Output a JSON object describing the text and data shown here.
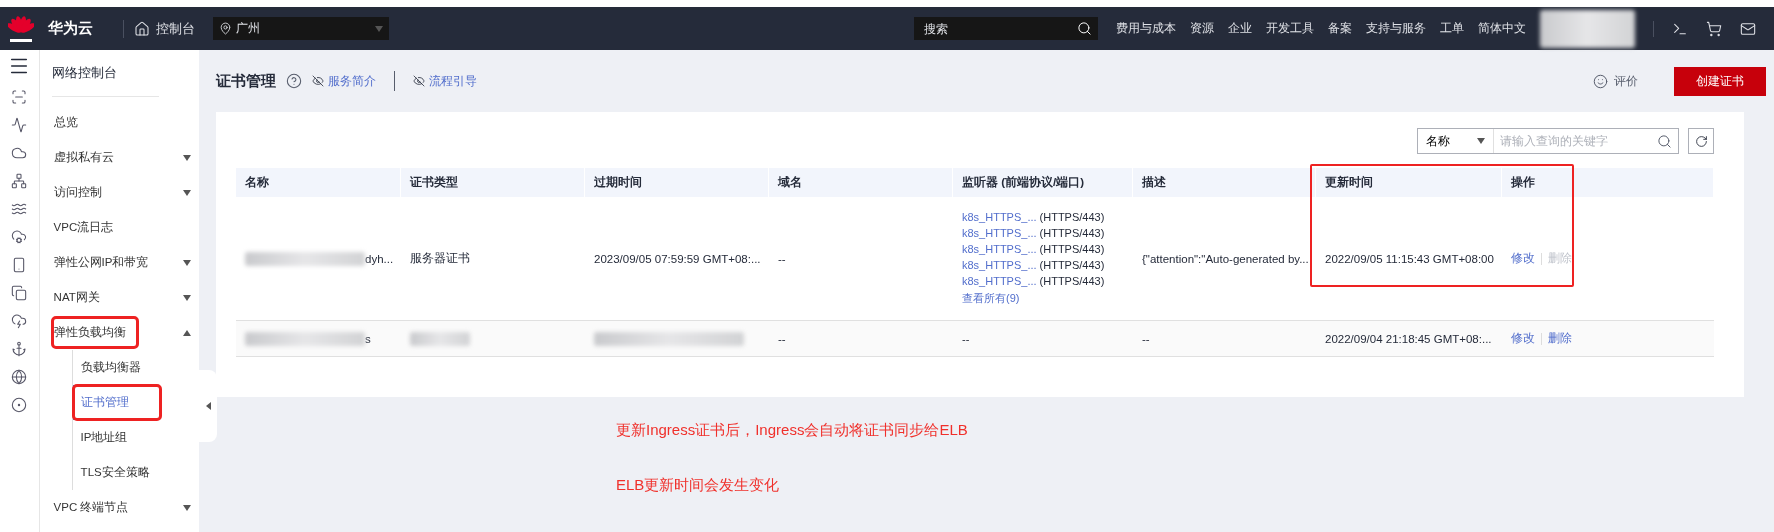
{
  "top_bar": {
    "brand": "华为云",
    "console": "控制台",
    "region": "广州",
    "search": {
      "placeholder": "搜索"
    },
    "nav": [
      "费用与成本",
      "资源",
      "企业",
      "开发工具",
      "备案",
      "支持与服务",
      "工单",
      "简体中文"
    ]
  },
  "sidebar": {
    "title": "网络控制台",
    "items": [
      {
        "label": "总览",
        "expandable": false,
        "highlighted": false
      },
      {
        "label": "虚拟私有云",
        "expandable": true,
        "expanded": false,
        "highlighted": false
      },
      {
        "label": "访问控制",
        "expandable": true,
        "expanded": false,
        "highlighted": false
      },
      {
        "label": "VPC流日志",
        "expandable": false,
        "highlighted": false
      },
      {
        "label": "弹性公网IP和带宽",
        "expandable": true,
        "expanded": false,
        "highlighted": false
      },
      {
        "label": "NAT网关",
        "expandable": true,
        "expanded": false,
        "highlighted": false
      },
      {
        "label": "弹性负载均衡",
        "expandable": true,
        "expanded": true,
        "highlighted": true,
        "children": [
          {
            "label": "负载均衡器",
            "selected": false,
            "highlighted": false
          },
          {
            "label": "证书管理",
            "selected": true,
            "highlighted": true
          },
          {
            "label": "IP地址组",
            "selected": false,
            "highlighted": false
          },
          {
            "label": "TLS安全策略",
            "selected": false,
            "highlighted": false
          }
        ]
      },
      {
        "label": "VPC 终端节点",
        "expandable": true,
        "expanded": false,
        "highlighted": false
      }
    ]
  },
  "page": {
    "title": "证书管理",
    "links": [
      "服务简介",
      "流程引导"
    ],
    "feedback": "评价",
    "create_button": "创建证书"
  },
  "filter": {
    "field": "名称",
    "placeholder": "请输入查询的关键字"
  },
  "table": {
    "update_time_highlighted": true,
    "columns": [
      "名称",
      "证书类型",
      "过期时间",
      "域名",
      "监听器 (前端协议/端口)",
      "描述",
      "更新时间",
      "操作"
    ],
    "rows": [
      {
        "name": {
          "text": "dyh...",
          "redacted": true
        },
        "type": {
          "text": "服务器证书",
          "redacted": false
        },
        "expiry": {
          "text": "2023/09/05 07:59:59 GMT+08:...",
          "redacted": false
        },
        "domain": "--",
        "listeners": [
          {
            "name": "k8s_HTTPS_...",
            "protocol": "(HTTPS/443)"
          },
          {
            "name": "k8s_HTTPS_...",
            "protocol": "(HTTPS/443)"
          },
          {
            "name": "k8s_HTTPS_...",
            "protocol": "(HTTPS/443)"
          },
          {
            "name": "k8s_HTTPS_...",
            "protocol": "(HTTPS/443)"
          },
          {
            "name": "k8s_HTTPS_...",
            "protocol": "(HTTPS/443)"
          }
        ],
        "listeners_more": "查看所有(9)",
        "description": "{\"attention\":\"Auto-generated by...",
        "updated": "2022/09/05 11:15:43 GMT+08:00",
        "actions": [
          {
            "label": "修改",
            "disabled": false
          },
          {
            "label": "删除",
            "disabled": true
          }
        ]
      },
      {
        "name": {
          "text": "s",
          "redacted": true
        },
        "type": {
          "redacted": true
        },
        "expiry": {
          "redacted": true
        },
        "domain": "--",
        "listeners": [],
        "listeners_empty": "--",
        "description": "--",
        "updated": "2022/09/04 21:18:45 GMT+08:...",
        "actions": [
          {
            "label": "修改",
            "disabled": false
          },
          {
            "label": "删除",
            "disabled": false
          }
        ]
      }
    ]
  },
  "notes": [
    "更新Ingress证书后，Ingress会自动将证书同步给ELB",
    "ELB更新时间会发生变化"
  ]
}
